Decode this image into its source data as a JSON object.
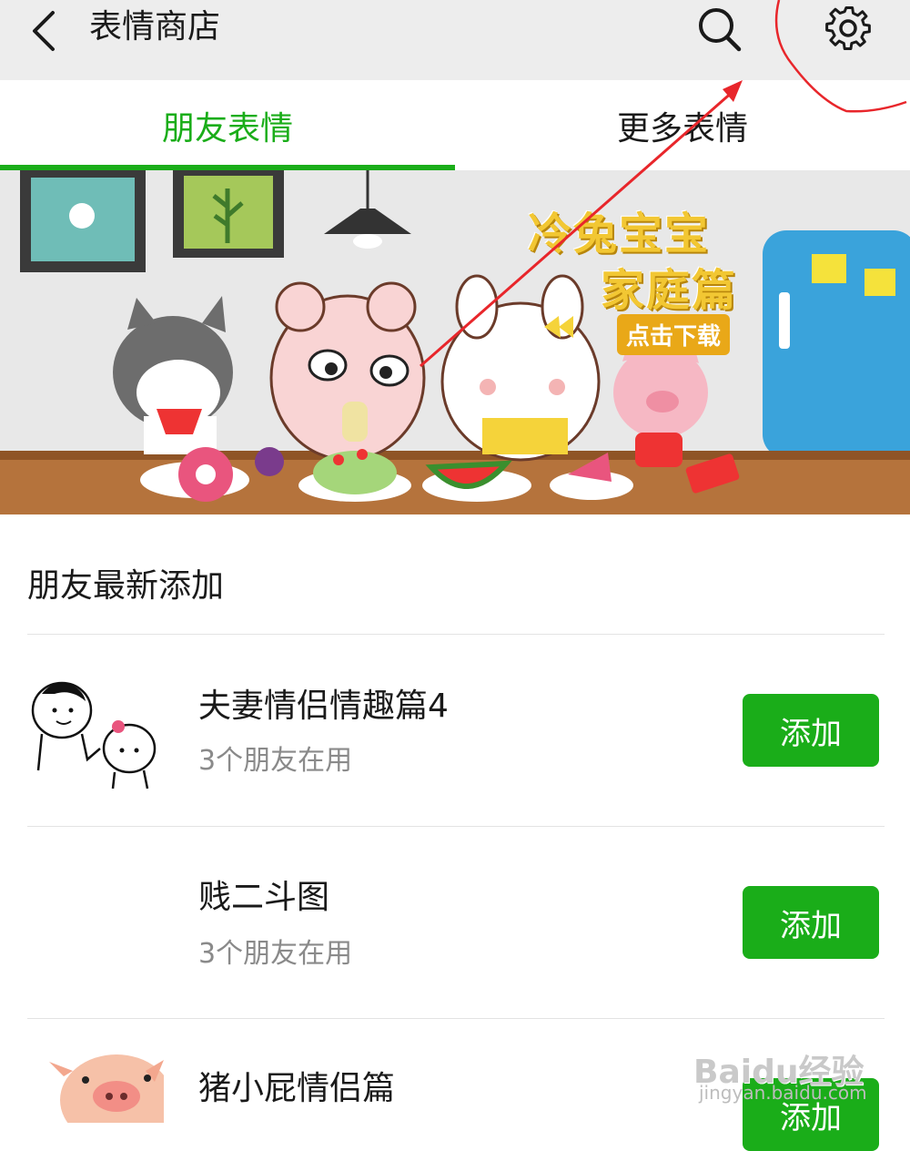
{
  "header": {
    "title": "表情商店",
    "back_icon": "chevron-left-icon",
    "search_icon": "search-icon",
    "settings_icon": "gear-icon"
  },
  "tabs": [
    {
      "label": "朋友表情",
      "active": true
    },
    {
      "label": "更多表情",
      "active": false
    }
  ],
  "banner": {
    "title_line1": "冷兔宝宝",
    "title_line2": "家庭篇",
    "cta": "点击下载"
  },
  "section": {
    "title": "朋友最新添加"
  },
  "items": [
    {
      "name": "夫妻情侣情趣篇4",
      "subtitle": "3个朋友在用",
      "button": "添加"
    },
    {
      "name": "贱二斗图",
      "subtitle": "3个朋友在用",
      "button": "添加"
    },
    {
      "name": "猪小屁情侣篇",
      "subtitle": "",
      "button": "添加"
    }
  ],
  "watermark": {
    "brand": "Baidu经验",
    "url": "jingyan.baidu.com"
  },
  "colors": {
    "accent": "#1aad19",
    "header_bg": "#ededed",
    "annotation": "#e8262b"
  }
}
